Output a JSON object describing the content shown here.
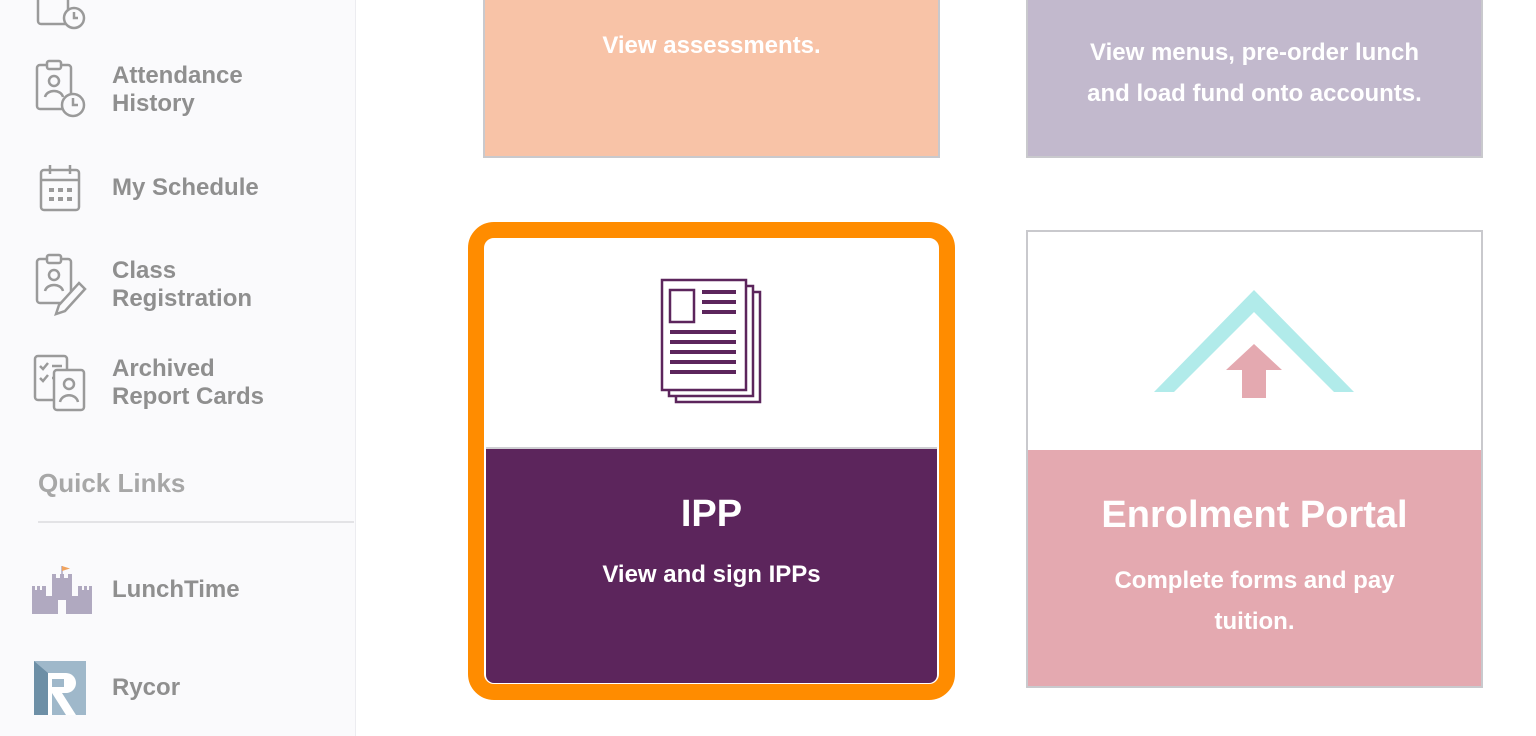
{
  "sidebar": {
    "items": [
      {
        "label": "Attendance\nHistory",
        "icon": "attendance-history-icon"
      },
      {
        "label": "My Schedule",
        "icon": "calendar-icon"
      },
      {
        "label": "Class\nRegistration",
        "icon": "class-registration-icon"
      },
      {
        "label": "Archived\nReport Cards",
        "icon": "report-cards-icon"
      }
    ],
    "quick_links_title": "Quick Links",
    "quick_links": [
      {
        "label": "LunchTime",
        "icon": "lunchtime-castle-icon"
      },
      {
        "label": "Rycor",
        "icon": "rycor-logo-icon"
      }
    ]
  },
  "cards": {
    "assessments": {
      "description": "View assessments."
    },
    "lunch": {
      "description": "View menus, pre-order lunch\nand load fund onto accounts."
    },
    "ipp": {
      "title": "IPP",
      "description": "View and sign IPPs",
      "icon": "documents-icon"
    },
    "enrolment": {
      "title": "Enrolment Portal",
      "description": "Complete forms and pay\ntuition.",
      "icon": "house-arrow-icon"
    }
  },
  "colors": {
    "highlight_outline": "#ff8c00",
    "ipp_purple": "#5c255c",
    "enrol_pink": "#e4a9b0",
    "assess_peach": "#f8c3a7",
    "lunch_lavender": "#c2b9cd",
    "sidebar_text": "#8f8f8f"
  }
}
